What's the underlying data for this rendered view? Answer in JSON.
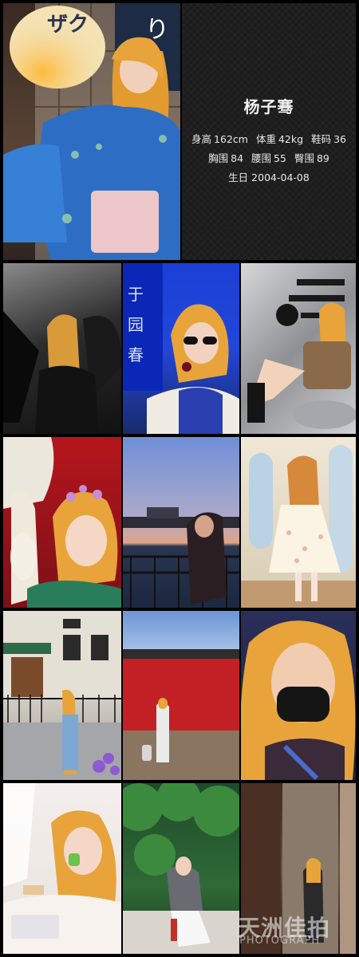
{
  "profile": {
    "name": "杨子骞",
    "height_label": "身高",
    "height_value": "162cm",
    "weight_label": "体重",
    "weight_value": "42kg",
    "shoe_label": "鞋码",
    "shoe_value": "36",
    "bust_label": "胸围",
    "bust_value": "84",
    "waist_label": "腰围",
    "waist_value": "55",
    "hip_label": "臀围",
    "hip_value": "89",
    "birthday_label": "生日",
    "birthday_value": "2004-04-08"
  },
  "lantern_text": "ザク",
  "banner_text": "り",
  "photo_sign_text": "于 园 春",
  "watermark": {
    "big": "天洲佳拍",
    "small": "PHOTOGRAPH"
  },
  "colors": {
    "background": "#000000",
    "panel": "#1c1c1c",
    "text": "#f2f2f2",
    "hair": "#e8a43a"
  }
}
